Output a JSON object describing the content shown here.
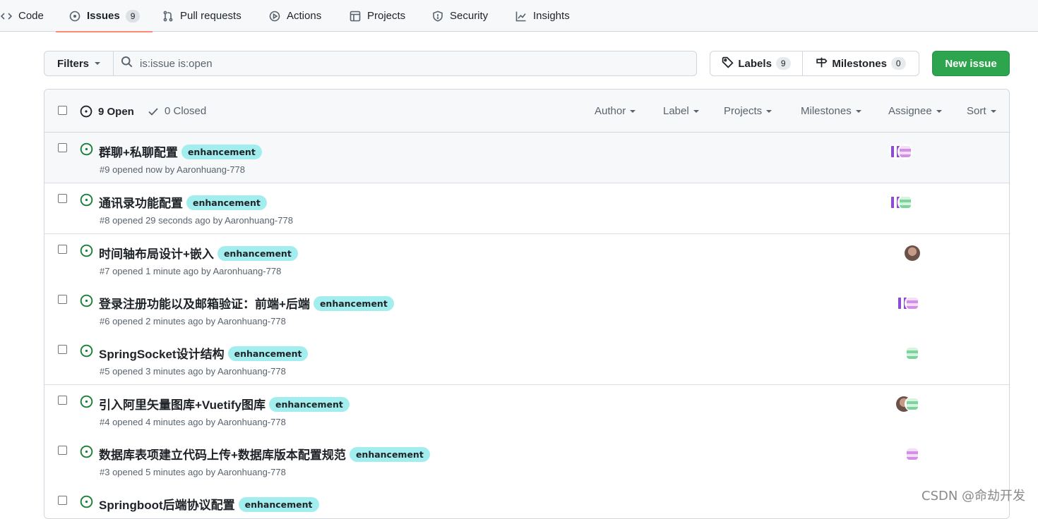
{
  "nav": {
    "tabs": [
      {
        "label": "Code",
        "icon": "code-icon"
      },
      {
        "label": "Issues",
        "icon": "issue-opened-icon",
        "count": "9",
        "selected": true
      },
      {
        "label": "Pull requests",
        "icon": "git-pull-request-icon"
      },
      {
        "label": "Actions",
        "icon": "play-icon"
      },
      {
        "label": "Projects",
        "icon": "table-icon"
      },
      {
        "label": "Security",
        "icon": "shield-icon"
      },
      {
        "label": "Insights",
        "icon": "graph-icon"
      }
    ]
  },
  "subnav": {
    "filters_label": "Filters",
    "search_value": "is:issue is:open",
    "labels_label": "Labels",
    "labels_count": "9",
    "milestones_label": "Milestones",
    "milestones_count": "0",
    "new_issue_label": "New issue"
  },
  "header": {
    "open_label": "9 Open",
    "closed_label": "0 Closed",
    "filters": [
      "Author",
      "Label",
      "Projects",
      "Milestones",
      "Assignee",
      "Sort"
    ]
  },
  "issues": [
    {
      "title": "群聊+私聊配置",
      "label": "enhancement",
      "meta": "#9 opened now by Aaronhuang-778"
    },
    {
      "title": "通讯录功能配置",
      "label": "enhancement",
      "meta": "#8 opened 29 seconds ago by Aaronhuang-778"
    },
    {
      "title": "时间轴布局设计+嵌入",
      "label": "enhancement",
      "meta": "#7 opened 1 minute ago by Aaronhuang-778"
    },
    {
      "title": "登录注册功能以及邮箱验证：前端+后端",
      "label": "enhancement",
      "meta": "#6 opened 2 minutes ago by Aaronhuang-778"
    },
    {
      "title": "SpringSocket设计结构",
      "label": "enhancement",
      "meta": "#5 opened 3 minutes ago by Aaronhuang-778"
    },
    {
      "title": "引入阿里矢量图库+Vuetify图库",
      "label": "enhancement",
      "meta": "#4 opened 4 minutes ago by Aaronhuang-778"
    },
    {
      "title": "数据库表项建立代码上传+数据库版本配置规范",
      "label": "enhancement",
      "meta": "#3 opened 5 minutes ago by Aaronhuang-778"
    },
    {
      "title": "Springboot后端协议配置",
      "label": "enhancement",
      "meta": ""
    }
  ],
  "colors": {
    "accent_green": "#2da44e",
    "open_icon": "#1a7f37",
    "label_bg": "#a2eeef",
    "tab_underline": "#fd8c73"
  },
  "watermark": "CSDN @命劫开发"
}
